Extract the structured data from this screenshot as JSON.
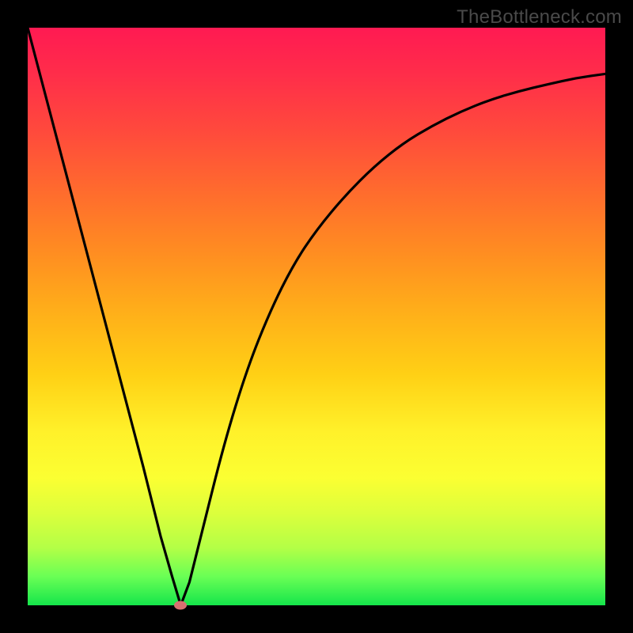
{
  "watermark": "TheBottleneck.com",
  "colors": {
    "frame": "#000000",
    "curve_stroke": "#000000",
    "marker_fill": "#d87070",
    "gradient_top": "#ff1a52",
    "gradient_bottom": "#15e54b"
  },
  "chart_data": {
    "type": "line",
    "title": "",
    "xlabel": "",
    "ylabel": "",
    "xlim": [
      0,
      100
    ],
    "ylim": [
      0,
      100
    ],
    "grid": false,
    "legend": false,
    "x": [
      0,
      5,
      10,
      15,
      20,
      23,
      25,
      26.5,
      28,
      30,
      34,
      38,
      42,
      46,
      50,
      55,
      60,
      65,
      70,
      75,
      80,
      85,
      90,
      95,
      100
    ],
    "values": [
      100,
      81,
      62,
      43,
      24,
      12,
      5,
      0,
      4,
      12,
      28,
      41,
      51,
      59,
      65,
      71,
      76,
      80,
      83,
      85.5,
      87.5,
      89,
      90.2,
      91.3,
      92
    ],
    "minimum_marker": {
      "x": 26.5,
      "y": 0
    },
    "notes": "y values are relative (0 = green bottom, 100 = red top); curve has a sharp V minimum near x≈26.5 then rises asymptotically toward ~92."
  }
}
